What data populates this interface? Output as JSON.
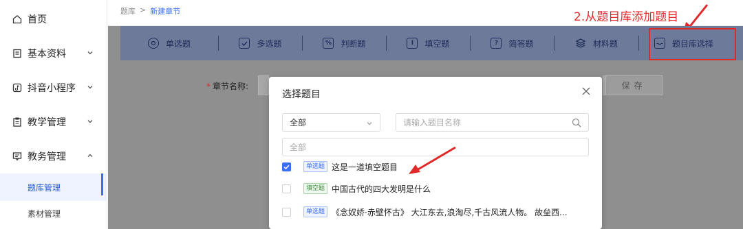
{
  "sidebar": {
    "items": [
      {
        "label": "首页",
        "icon": "home-icon"
      },
      {
        "label": "基本资料",
        "icon": "doc-icon"
      },
      {
        "label": "抖音小程序",
        "icon": "tiktok-icon"
      },
      {
        "label": "教学管理",
        "icon": "clipboard-icon"
      },
      {
        "label": "教务管理",
        "icon": "message-icon"
      }
    ],
    "subitems": [
      {
        "label": "题库管理"
      },
      {
        "label": "素材管理"
      }
    ]
  },
  "breadcrumb": {
    "root": "题库",
    "sep": ">",
    "current": "新建章节"
  },
  "annotation": {
    "step2": "2.从题目库添加题目"
  },
  "toolbar": {
    "items": [
      {
        "label": "单选题",
        "icon": "radio-circle-icon"
      },
      {
        "label": "多选题",
        "icon": "checkbox-icon"
      },
      {
        "label": "判断题",
        "icon": "percent-icon"
      },
      {
        "label": "填空题",
        "icon": "text-cursor-icon"
      },
      {
        "label": "简答题",
        "icon": "question-icon"
      },
      {
        "label": "材料题",
        "icon": "layers-icon"
      },
      {
        "label": "题目库选择",
        "icon": "inbox-icon"
      }
    ]
  },
  "form": {
    "chapter_label": "章节名称:",
    "save_label": "保存"
  },
  "modal": {
    "title": "选择题目",
    "type_select": "全部",
    "search_placeholder": "请输入题目名称",
    "filter_placeholder": "全部",
    "questions": [
      {
        "tag": "单选题",
        "text": "这是一道填空题目",
        "checked": true
      },
      {
        "tag": "填空题",
        "text": "中国古代的四大发明是什么",
        "checked": false
      },
      {
        "tag": "单选题",
        "text": "《念奴娇·赤壁怀古》 大江东去,浪淘尽,千古风流人物。 故垒西...",
        "checked": false
      }
    ]
  },
  "colors": {
    "accent": "#3a6ff5",
    "annotation": "#e02a2a",
    "toolbar_bg": "#6e7a99"
  }
}
